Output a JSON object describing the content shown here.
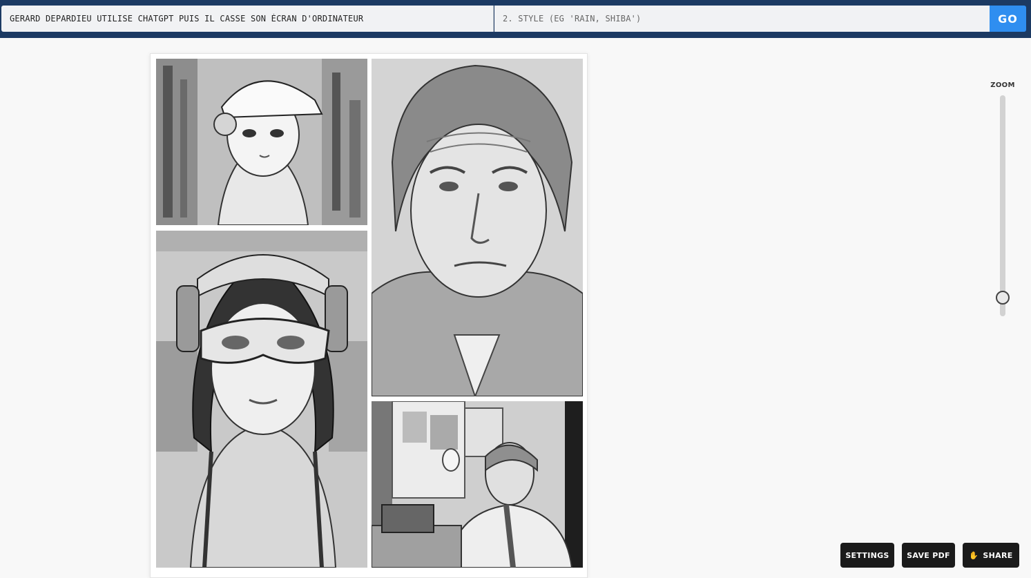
{
  "header": {
    "prompt_value": "Gerard Depardieu utilise chatgpt puis il casse son écran d'ordinateur",
    "style_placeholder": "2. Style (eg 'rain, shiba')",
    "go_label": "GO"
  },
  "canvas": {
    "panels": [
      {
        "name": "panel-anime-girl-cap",
        "icon": "manga-girl-cap-image"
      },
      {
        "name": "panel-portrait-man",
        "icon": "portrait-man-image"
      },
      {
        "name": "panel-anime-girl-goggles",
        "icon": "manga-girl-goggles-image"
      },
      {
        "name": "panel-man-at-desk",
        "icon": "man-at-desk-image"
      }
    ]
  },
  "zoom": {
    "label": "ZOOM",
    "level": 0.95
  },
  "actions": {
    "settings_label": "Settings",
    "save_pdf_label": "Save PDF",
    "share_label": "Share",
    "share_icon": "hand-coin-icon"
  },
  "colors": {
    "header_bg": "#1c3a63",
    "go_button": "#2f8ef0",
    "action_button_bg": "#1b1b1b"
  }
}
